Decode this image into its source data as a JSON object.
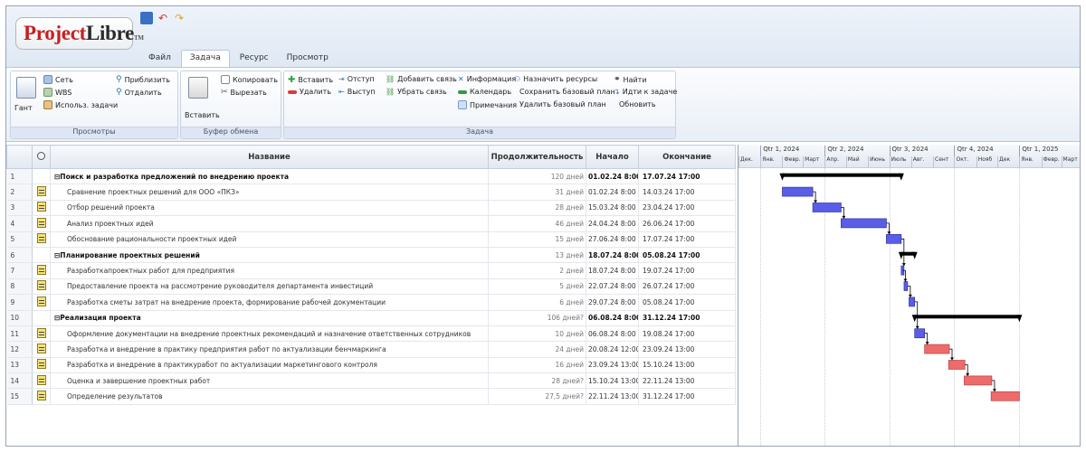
{
  "app": {
    "logo_a": "Project",
    "logo_b": "Libre",
    "logo_tm": "TM",
    "quick_access": [
      "save-icon",
      "undo-icon",
      "redo-icon"
    ]
  },
  "menu_tabs": [
    {
      "label": "Файл",
      "active": false
    },
    {
      "label": "Задача",
      "active": true
    },
    {
      "label": "Ресурс",
      "active": false
    },
    {
      "label": "Просмотр",
      "active": false
    }
  ],
  "ribbon": {
    "views": {
      "title": "Просмотры",
      "gantt": "Гант",
      "network": "Сеть",
      "wbs": "WBS",
      "task_usage": "Использ. задачи",
      "zoom_in": "Приблизить",
      "zoom_out": "Отдалить"
    },
    "clipboard": {
      "title": "Буфер обмена",
      "paste": "Вставить",
      "copy": "Копировать",
      "cut": "Вырезать"
    },
    "task": {
      "title": "Задача",
      "insert": "Вставить",
      "delete": "Удалить",
      "indent": "Отступ",
      "outdent": "Выступ",
      "link": "Добавить связь",
      "unlink": "Убрать связь",
      "info": "Информация",
      "calendar": "Календарь",
      "notes": "Примечания",
      "assign": "Назначить ресурсы",
      "save_baseline": "Сохранить базовый план",
      "clear_baseline": "Удалить базовый план",
      "find": "Найти",
      "goto": "Идти к задаче",
      "update": "Обновить"
    }
  },
  "columns": {
    "name": "Название",
    "duration": "Продолжительность",
    "start": "Начало",
    "finish": "Окончание"
  },
  "tasks": [
    {
      "id": "1",
      "summary": true,
      "name": "Поиск и разработка предложений по внедрению проекта",
      "duration": "120 дней",
      "start": "01.02.24 8:00",
      "finish": "17.07.24 17:00"
    },
    {
      "id": "2",
      "summary": false,
      "name": "Сравнение проектных решений для ООО «ПКЗ»",
      "duration": "31 дней",
      "start": "01.02.24 8:00",
      "finish": "14.03.24 17:00"
    },
    {
      "id": "3",
      "summary": false,
      "name": "Отбор решений проекта",
      "duration": "28 дней",
      "start": "15.03.24 8:00",
      "finish": "23.04.24 17:00"
    },
    {
      "id": "4",
      "summary": false,
      "name": "Анализ проектных идей",
      "duration": "46 дней",
      "start": "24.04.24 8:00",
      "finish": "26.06.24 17:00"
    },
    {
      "id": "5",
      "summary": false,
      "name": "Обоснование рациональности проектных идей",
      "duration": "15 дней",
      "start": "27.06.24 8:00",
      "finish": "17.07.24 17:00"
    },
    {
      "id": "6",
      "summary": true,
      "name": "Планирование проектных решений",
      "duration": "13 дней",
      "start": "18.07.24 8:00",
      "finish": "05.08.24 17:00"
    },
    {
      "id": "7",
      "summary": false,
      "name": "Разработкапроектных работ для предприятия",
      "duration": "2 дней",
      "start": "18.07.24 8:00",
      "finish": "19.07.24 17:00"
    },
    {
      "id": "8",
      "summary": false,
      "name": "Предоставление проекта на рассмотрение руководителя департамента инвестиций",
      "duration": "5 дней",
      "start": "22.07.24 8:00",
      "finish": "26.07.24 17:00"
    },
    {
      "id": "9",
      "summary": false,
      "name": "Разработка сметы затрат на внедрение проекта, формирование рабочей документации",
      "duration": "6 дней",
      "start": "29.07.24 8:00",
      "finish": "05.08.24 17:00"
    },
    {
      "id": "10",
      "summary": true,
      "name": "Реализация проекта",
      "duration": "106 дней?",
      "start": "06.08.24 8:00",
      "finish": "31.12.24 17:00"
    },
    {
      "id": "11",
      "summary": false,
      "name": "Оформление документации на внедрение проектных рекомендаций и назначение ответственных сотрудников",
      "duration": "10 дней",
      "start": "06.08.24 8:00",
      "finish": "19.08.24 17:00"
    },
    {
      "id": "12",
      "summary": false,
      "name": "Разработка и внедрение в практику предприятия работ по актуализации бенчмаркинга",
      "duration": "24 дней",
      "start": "20.08.24 12:00",
      "finish": "23.09.24 13:00"
    },
    {
      "id": "13",
      "summary": false,
      "name": "Разработка и внедрение в практикуработ по актуализации маркетингового контроля",
      "duration": "16 дней",
      "start": "23.09.24 13:00",
      "finish": "15.10.24 13:00"
    },
    {
      "id": "14",
      "summary": false,
      "name": "Оценка и завершение проектных работ",
      "duration": "28 дней?",
      "start": "15.10.24 13:00",
      "finish": "22.11.24 13:00"
    },
    {
      "id": "15",
      "summary": false,
      "name": "Определение результатов",
      "duration": "27,5 дней?",
      "start": "22.11.24 13:00",
      "finish": "31.12.24 17:00"
    }
  ],
  "gantt": {
    "quarters": [
      "Qtr 1, 2024",
      "Qtr 2, 2024",
      "Qtr 3, 2024",
      "Qtr 4, 2024",
      "Qtr 1, 2025"
    ],
    "months": [
      "Дек.",
      "Янв.",
      "Февр.",
      "Март",
      "Апр.",
      "Май",
      "Июнь",
      "Июль",
      "Авг.",
      "Сент",
      "Окт.",
      "Нояб",
      "Дек",
      "Янв.",
      "Февр.",
      "Март"
    ],
    "colors": {
      "normal": "#5a5ee6",
      "critical": "#ee6b6b",
      "summary": "#000000"
    },
    "critical_rows": [
      "12",
      "13",
      "14",
      "15"
    ],
    "date_range": [
      "2023-12-01",
      "2025-03-31"
    ]
  }
}
